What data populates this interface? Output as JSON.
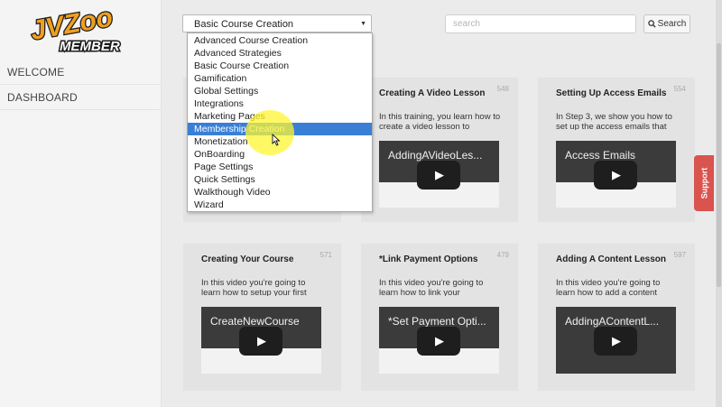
{
  "logo": {
    "brand": "JVZoo",
    "sub": "MEMBER"
  },
  "nav": [
    {
      "label": "WELCOME"
    },
    {
      "label": "DASHBOARD"
    }
  ],
  "filter": {
    "selected": "Basic Course Creation",
    "options": [
      "Advanced Course Creation",
      "Advanced Strategies",
      "Basic Course Creation",
      "Gamification",
      "Global Settings",
      "Integrations",
      "Marketing Pages",
      "Membership Creation",
      "Monetization",
      "OnBoarding",
      "Page Settings",
      "Quick Settings",
      "Walkthough Video",
      "Wizard"
    ],
    "highlighted": "Membership Creation"
  },
  "search": {
    "placeholder": "search",
    "button_label": "Search"
  },
  "support_label": "Support",
  "cards": [
    {
      "title": "Creating A Video Lesson",
      "number": "548",
      "desc": "In this training, you learn how to create a video lesson to",
      "video_title": "AddingAVideoLes..."
    },
    {
      "title": "Setting Up Access Emails",
      "number": "554",
      "desc": "In Step 3, we show you how to set up the access emails that",
      "video_title": "Access Emails"
    },
    {
      "title": "Creating Your Course",
      "number": "571",
      "desc": "In this video you're going to learn how to setup your first",
      "video_title": "CreateNewCourse"
    },
    {
      "title": "*Link Payment Options",
      "number": "479",
      "desc": "In this video you're going to learn how to link your",
      "video_title": "*Set Payment Opti..."
    },
    {
      "title": "Adding A Content Lesson",
      "number": "597",
      "desc": "In this video you're going to learn how to add a content",
      "video_title": "AddingAContentL..."
    }
  ],
  "colors": {
    "accent": "#3a7fd6",
    "support": "#d9534f",
    "logo_orange": "#f0a020"
  }
}
